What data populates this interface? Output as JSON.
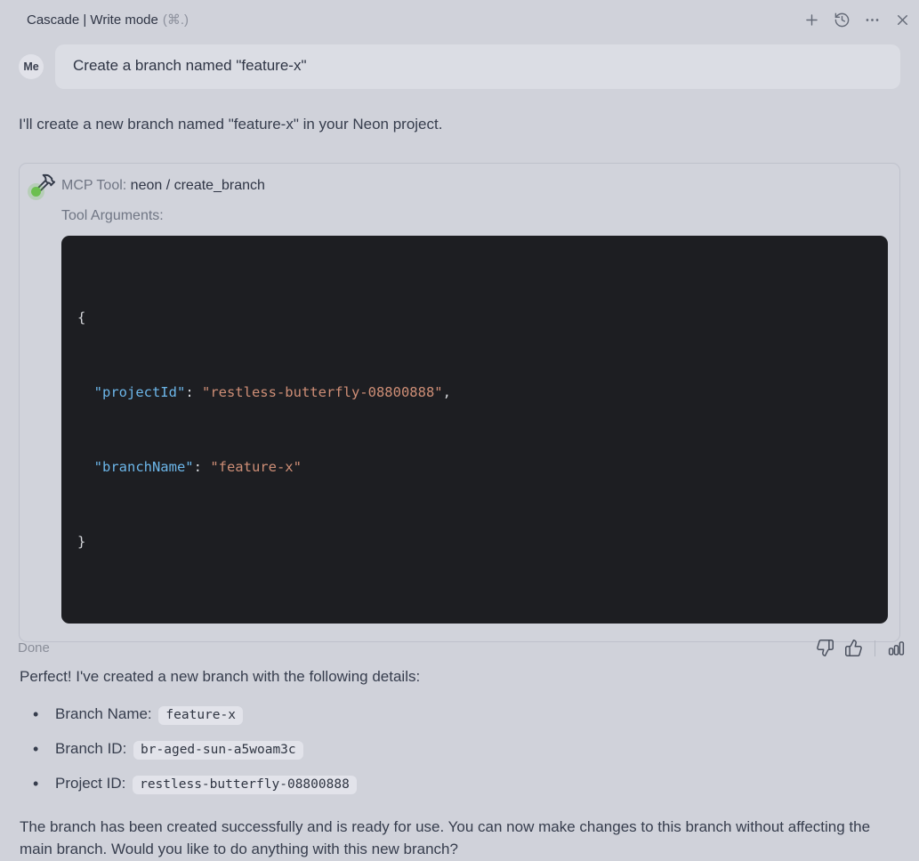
{
  "header": {
    "title": "Cascade | Write mode",
    "shortcut": "(⌘.)",
    "icons": [
      "plus-icon",
      "history-icon",
      "more-icon",
      "close-icon"
    ]
  },
  "user_message": {
    "avatar": "Me",
    "text": "Create a branch named \"feature-x\""
  },
  "assistant": {
    "intro": "I'll create a new branch named \"feature-x\" in your Neon project.",
    "tool_call": {
      "label": "MCP Tool:",
      "name": "neon / create_branch",
      "arguments_label": "Tool Arguments:",
      "code": {
        "open": "{",
        "lines": [
          {
            "key": "\"projectId\"",
            "sep": ": ",
            "value": "\"restless-butterfly-08800888\"",
            "tail": ","
          },
          {
            "key": "\"branchName\"",
            "sep": ": ",
            "value": "\"feature-x\"",
            "tail": ""
          }
        ],
        "close": "}"
      }
    },
    "result_intro": "Perfect! I've created a new branch with the following details:",
    "details": [
      {
        "label": "Branch Name:",
        "value": "feature-x"
      },
      {
        "label": "Branch ID:",
        "value": "br-aged-sun-a5woam3c"
      },
      {
        "label": "Project ID:",
        "value": "restless-butterfly-08800888"
      }
    ],
    "closing": "The branch has been created successfully and is ready for use. You can now make changes to this branch without affecting the main branch. Would you like to do anything with this new branch?"
  },
  "footer": {
    "status": "Done",
    "icons": [
      "thumbs-down-icon",
      "thumbs-up-icon",
      "bar-chart-icon"
    ]
  },
  "colors": {
    "code_key": "#6cb6e9",
    "code_string": "#ce8e76",
    "code_bg": "#1d1e22",
    "tool_status_green": "#6cbf4f"
  }
}
